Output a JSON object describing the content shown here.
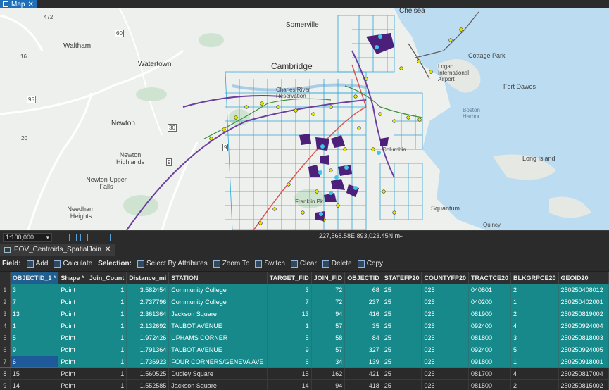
{
  "window": {
    "map_tab_label": "Map"
  },
  "map": {
    "labels": [
      "Chelsea",
      "Somerville",
      "Waltham",
      "Watertown",
      "Cambridge",
      "Cottage Park",
      "Logan International Airport",
      "Fort Dawes",
      "Charles River Reservation",
      "Boston Harbor",
      "Newton",
      "Long Island",
      "Newton Highlands",
      "Newton Upper Falls",
      "Needham Heights",
      "Squantum",
      "Quincy",
      "Franklin Pk",
      "Columbia",
      "60",
      "95",
      "472",
      "30",
      "9",
      "9",
      "16",
      "20"
    ]
  },
  "status": {
    "scale": "1:100,000",
    "coordinates": "227,568.58E 893,023.45N m"
  },
  "table_tab": {
    "label": "POV_Centroids_SpatialJoin"
  },
  "toolbar": {
    "field_label": "Field:",
    "add": "Add",
    "calculate": "Calculate",
    "selection_label": "Selection:",
    "select_by_attributes": "Select By Attributes",
    "zoom_to": "Zoom To",
    "switch": "Switch",
    "clear": "Clear",
    "delete": "Delete",
    "copy": "Copy"
  },
  "table": {
    "columns": [
      "OBJECTID_1 *",
      "Shape *",
      "Join_Count",
      "Distance_mi",
      "STATION",
      "TARGET_FID",
      "JOIN_FID",
      "OBJECTID",
      "STATEFP20",
      "COUNTYFP20",
      "TRACTCE20",
      "BLKGRPCE20",
      "GEOID20"
    ],
    "rows": [
      [
        "1",
        "3",
        "Point",
        "1",
        "3.582454",
        "Community College",
        "3",
        "72",
        "68",
        "25",
        "025",
        "040801",
        "2",
        "250250408012"
      ],
      [
        "2",
        "7",
        "Point",
        "1",
        "2.737796",
        "Community College",
        "7",
        "72",
        "237",
        "25",
        "025",
        "040200",
        "1",
        "250250402001"
      ],
      [
        "3",
        "13",
        "Point",
        "1",
        "2.361364",
        "Jackson Square",
        "13",
        "94",
        "416",
        "25",
        "025",
        "081900",
        "2",
        "250250819002"
      ],
      [
        "4",
        "1",
        "Point",
        "1",
        "2.132692",
        "TALBOT AVENUE",
        "1",
        "57",
        "35",
        "25",
        "025",
        "092400",
        "4",
        "250250924004"
      ],
      [
        "5",
        "5",
        "Point",
        "1",
        "1.972426",
        "UPHAMS CORNER",
        "5",
        "58",
        "84",
        "25",
        "025",
        "081800",
        "3",
        "250250818003"
      ],
      [
        "6",
        "9",
        "Point",
        "1",
        "1.791364",
        "TALBOT AVENUE",
        "9",
        "57",
        "327",
        "25",
        "025",
        "092400",
        "5",
        "250250924005"
      ],
      [
        "7",
        "6",
        "Point",
        "1",
        "1.736923",
        "FOUR CORNERS/GENEVA AVE",
        "6",
        "34",
        "139",
        "25",
        "025",
        "091800",
        "1",
        "250250918001"
      ],
      [
        "8",
        "15",
        "Point",
        "1",
        "1.560525",
        "Dudley Square",
        "15",
        "162",
        "421",
        "25",
        "025",
        "081700",
        "4",
        "250250817004"
      ],
      [
        "9",
        "14",
        "Point",
        "1",
        "1.552585",
        "Jackson Square",
        "14",
        "94",
        "418",
        "25",
        "025",
        "081500",
        "2",
        "250250815002"
      ]
    ]
  }
}
